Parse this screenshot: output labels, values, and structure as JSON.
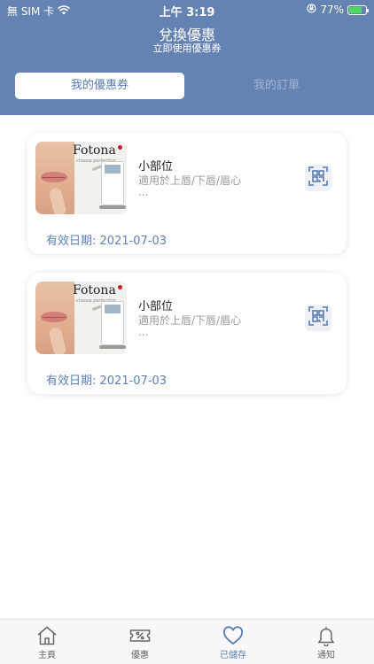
{
  "status_bar": {
    "carrier": "無 SIM 卡",
    "time": "上午 3:19",
    "battery": "77%",
    "battery_level": 0.77
  },
  "header": {
    "title": "兌換優惠",
    "subtitle": "立即使用優惠券"
  },
  "tabs": [
    {
      "label": "我的優惠券",
      "active": true
    },
    {
      "label": "我的訂單",
      "active": false
    }
  ],
  "coupons": [
    {
      "brand": "Fotona",
      "brand_tagline": "choose perfection",
      "title": "小部位",
      "description": "適用於上唇/下唇/眉心",
      "more": "...",
      "validity": "有效日期: 2021-07-03"
    },
    {
      "brand": "Fotona",
      "brand_tagline": "choose perfection",
      "title": "小部位",
      "description": "適用於上唇/下唇/眉心",
      "more": "...",
      "validity": "有效日期: 2021-07-03"
    }
  ],
  "tabbar": [
    {
      "label": "主頁",
      "icon": "home-icon",
      "active": false
    },
    {
      "label": "優惠",
      "icon": "coupon-icon",
      "active": false
    },
    {
      "label": "已儲存",
      "icon": "heart-icon",
      "active": true
    },
    {
      "label": "通知",
      "icon": "bell-icon",
      "active": false
    }
  ],
  "colors": {
    "header_bg": "#6583b2",
    "accent": "#5a7bb0",
    "date_text": "#5e7fb3",
    "battery_fill": "#4cd964"
  }
}
